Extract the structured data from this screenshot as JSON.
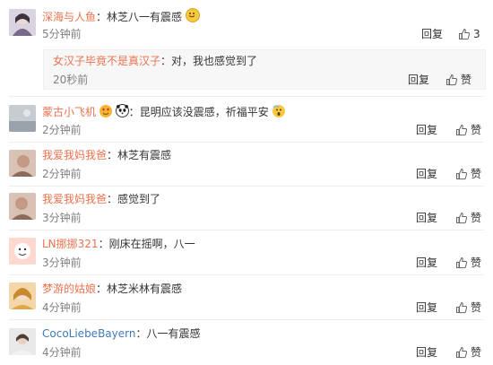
{
  "comments": [
    {
      "name": "深海与人鱼",
      "text": "林芝八一有震感",
      "time": "5分钟前",
      "reply": "回复",
      "like_count": "3",
      "emoji": "smile-emoji"
    },
    {
      "name": "蒙古小飞机",
      "text": "昆明应该没震感，祈福平安",
      "time": "2分钟前",
      "reply": "回复",
      "like_label": "赞",
      "emoji_after_name": [
        "heart-eyes-emoji",
        "panda-emoji"
      ],
      "emoji_after_text": "scared-emoji"
    },
    {
      "name": "我爱我妈我爸",
      "text": "林芝有震感",
      "time": "2分钟前",
      "reply": "回复",
      "like_label": "赞"
    },
    {
      "name": "我爱我妈我爸",
      "text": "感觉到了",
      "time": "3分钟前",
      "reply": "回复",
      "like_label": "赞"
    },
    {
      "name": "LN挪挪321",
      "text": "刚床在摇啊，八一",
      "time": "3分钟前",
      "reply": "回复",
      "like_label": "赞"
    },
    {
      "name": "梦游的姑娘",
      "text": "林芝米林有震感",
      "time": "4分钟前",
      "reply": "回复",
      "like_label": "赞"
    },
    {
      "name": "CocoLiebeBayern",
      "text": "八一有震感",
      "time": "4分钟前",
      "reply": "回复",
      "like_label": "赞"
    }
  ],
  "sub_reply": {
    "name": "女汉子毕竟不是真汉子",
    "text": "对，我也感觉到了",
    "time": "20秒前",
    "reply": "回复",
    "like_label": "赞"
  },
  "separator": "：",
  "colors": {
    "username": "#eb7350",
    "username_blue": "#3f7bb9",
    "time": "#808080",
    "divider": "#eeeeee"
  }
}
